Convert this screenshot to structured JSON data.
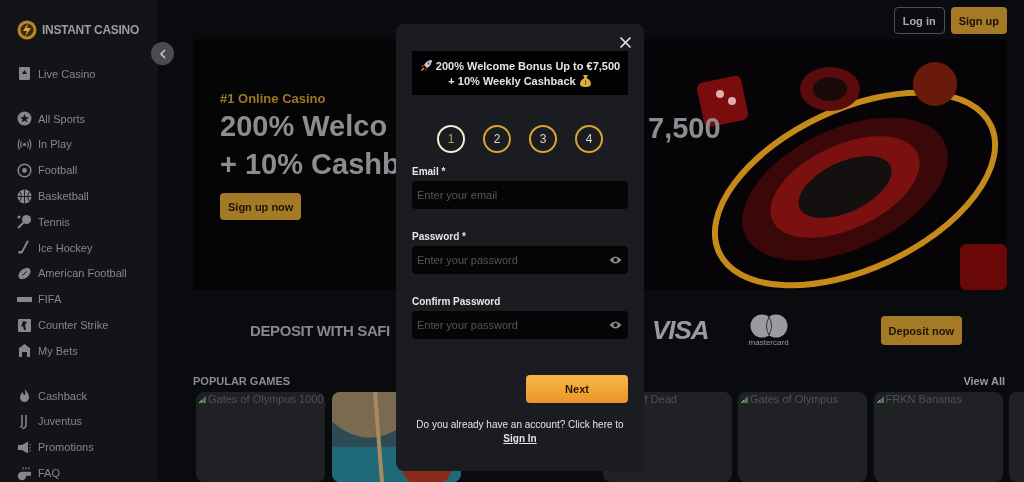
{
  "sidebar": {
    "logo": "INSTANT CASINO",
    "groups": [
      [
        {
          "label": "Live Casino"
        }
      ],
      [
        {
          "label": "All Sports"
        },
        {
          "label": "In Play"
        },
        {
          "label": "Football"
        },
        {
          "label": "Basketball"
        },
        {
          "label": "Tennis"
        },
        {
          "label": "Ice Hockey"
        },
        {
          "label": "American Football"
        },
        {
          "label": "FIFA"
        },
        {
          "label": "Counter Strike"
        },
        {
          "label": "My Bets"
        }
      ],
      [
        {
          "label": "Cashback"
        },
        {
          "label": "Juventus"
        },
        {
          "label": "Promotions"
        },
        {
          "label": "FAQ"
        }
      ]
    ]
  },
  "header": {
    "buttons": [
      {
        "label": "Log in",
        "kind": "outline"
      },
      {
        "label": "Sign up",
        "kind": "filled"
      }
    ]
  },
  "banner": {
    "eyebrow": "#1 Online Casino",
    "heading_lines": [
      "200% Welco",
      "+ 10% Cashb"
    ],
    "heading_tail": "7,500",
    "button": "Sign up now",
    "image": {
      "kind": "picture"
    }
  },
  "deposit": {
    "title": "DEPOSIT WITH SAFI",
    "visa": "VISA",
    "mastercard": "mastercard",
    "button": "Deposit now"
  },
  "games": {
    "title": "POPULAR GAMES",
    "view_all": "View All",
    "cards": [
      {
        "kind": "broken",
        "title": "Gates of Olympus 1000"
      },
      {
        "kind": "picture"
      },
      {
        "kind": "hidden"
      },
      {
        "kind": "covered",
        "title": "f Dead"
      },
      {
        "kind": "broken",
        "title": "Gates of Olympus"
      },
      {
        "kind": "broken",
        "title": "FRKN Bananas"
      },
      {
        "kind": "edge"
      }
    ]
  },
  "modal": {
    "promo_lines": [
      "200% Welcome Bonus Up to €7,500",
      "+ 10% Weekly Cashback"
    ],
    "steps": [
      {
        "label": "1",
        "selected": true
      },
      {
        "label": "2",
        "selected": false
      },
      {
        "label": "3",
        "selected": false
      },
      {
        "label": "4",
        "selected": false
      }
    ],
    "fields": [
      {
        "label": "Email *",
        "placeholder": "Enter your email",
        "kind": "text"
      },
      {
        "label": "Password *",
        "placeholder": "Enter your password",
        "kind": "password"
      },
      {
        "label": "Confirm Password",
        "placeholder": "Enter your password",
        "kind": "password"
      }
    ],
    "next_button": "Next",
    "footer_text": "Do you already have an account? Click here to",
    "sign_in_link": "Sign In"
  }
}
